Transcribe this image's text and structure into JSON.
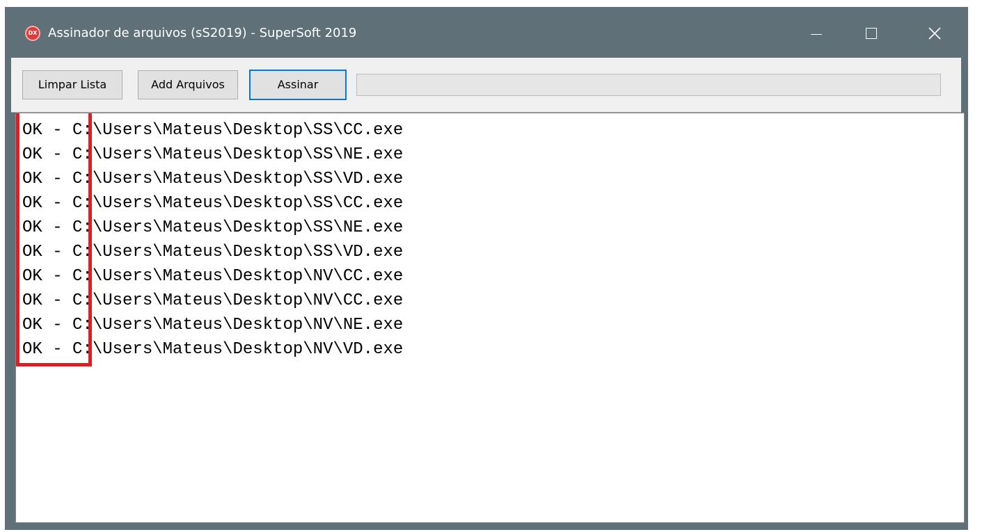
{
  "window": {
    "title": "Assinador de arquivos (sS2019) - SuperSoft 2019",
    "app_icon_text": "DX"
  },
  "toolbar": {
    "clear_label": "Limpar Lista",
    "add_label": "Add Arquivos",
    "sign_label": "Assinar",
    "progress_percent": 0
  },
  "list": {
    "items": [
      "OK - C:\\Users\\Mateus\\Desktop\\SS\\CC.exe",
      "OK - C:\\Users\\Mateus\\Desktop\\SS\\NE.exe",
      "OK - C:\\Users\\Mateus\\Desktop\\SS\\VD.exe",
      "OK - C:\\Users\\Mateus\\Desktop\\SS\\CC.exe",
      "OK - C:\\Users\\Mateus\\Desktop\\SS\\NE.exe",
      "OK - C:\\Users\\Mateus\\Desktop\\SS\\VD.exe",
      "OK - C:\\Users\\Mateus\\Desktop\\NV\\CC.exe",
      "OK - C:\\Users\\Mateus\\Desktop\\NV\\CC.exe",
      "OK - C:\\Users\\Mateus\\Desktop\\NV\\NE.exe",
      "OK - C:\\Users\\Mateus\\Desktop\\NV\\VD.exe"
    ]
  },
  "colors": {
    "titlebar": "#5f7079",
    "highlight": "#e31c24",
    "focus": "#0078d7"
  }
}
